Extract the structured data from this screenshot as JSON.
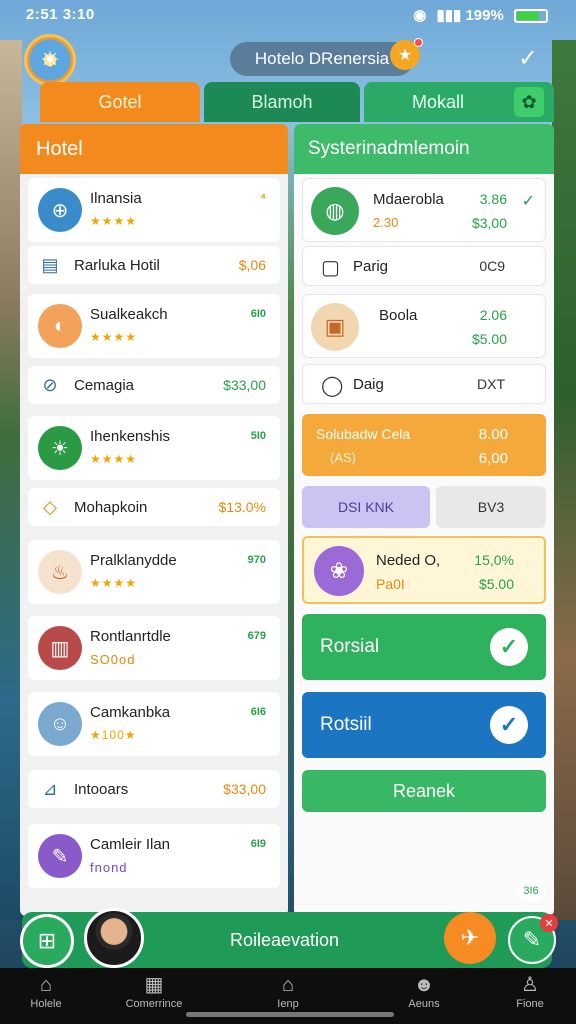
{
  "status": {
    "left": "2:51 3:10",
    "right": "199%"
  },
  "header": {
    "title": "Hotelo DRenersia"
  },
  "tabs": [
    {
      "label": "Gotel"
    },
    {
      "label": "Blamoh"
    },
    {
      "label": "Mokall"
    }
  ],
  "left": {
    "title": "Hotel",
    "items": [
      {
        "name": "Ilnansia",
        "sub": "★★★★",
        "value": "⁴"
      },
      {
        "name": "Rarluka Hotil",
        "value": "$,06"
      },
      {
        "name": "Sualkeakch",
        "sub": "★★★★",
        "value": "6I0"
      },
      {
        "name": "Cemagia",
        "value": "$33,00"
      },
      {
        "name": "Ihenkenshis",
        "sub": "★★★★",
        "value": "5I0"
      },
      {
        "name": "Mohapkoin",
        "value": "$13.0%"
      },
      {
        "name": "Pralklanydde",
        "sub": "★★★★",
        "value": "970"
      },
      {
        "name": "Rontlanrtdle",
        "sub": "SO0od",
        "value": "679"
      },
      {
        "name": "Camkanbka",
        "sub": "★100★",
        "value": "6I6"
      },
      {
        "name": "Intooars",
        "value": "$33,00"
      },
      {
        "name": "Camleir Ilan",
        "sub": "fnond",
        "value": "6I9"
      }
    ]
  },
  "right": {
    "title": "Systerinadmlemoin",
    "items": [
      {
        "name": "Mdaerobla",
        "sub": "2.30",
        "p1": "3.86",
        "p2": "$3,00"
      },
      {
        "name": "Parig",
        "value": "0C9"
      },
      {
        "name": "Boola",
        "p1": "2.06",
        "p2": "$5.00"
      },
      {
        "name": "Daig",
        "value": "DXT"
      }
    ],
    "promo": {
      "name": "Solubadw Cela",
      "sub": "(AS)",
      "p1": "8.00",
      "p2": "6,00"
    },
    "chips": [
      "DSI KNK",
      "BV3"
    ],
    "featured": {
      "name": "Neded O,",
      "sub": "Pa0I",
      "p1": "15,0%",
      "p2": "$5.00"
    },
    "actions": [
      "Rorsial",
      "Rotsiil",
      "Reanek"
    ]
  },
  "bottom": {
    "label": "Roileaevation",
    "mini_badge": "3I6"
  },
  "nav": [
    "Holele",
    "Comerrince",
    "Ienp",
    "Aeuns",
    "Fione"
  ]
}
